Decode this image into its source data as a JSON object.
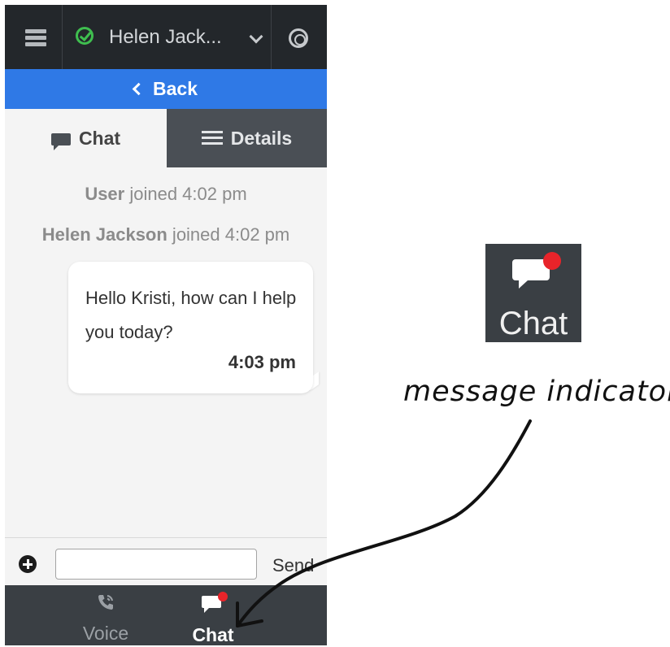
{
  "header": {
    "agent_name": "Helen Jack...",
    "status_color": "#3fbe4f"
  },
  "back_bar": {
    "label": "Back",
    "color": "#2f79e6"
  },
  "tabs": [
    {
      "label": "Chat",
      "icon": "chat-bubble-icon",
      "active": true
    },
    {
      "label": "Details",
      "icon": "list-icon",
      "active": false
    }
  ],
  "transcript": {
    "system_messages": [
      {
        "name": "User",
        "text": " joined 4:02 pm"
      },
      {
        "name": "Helen Jackson",
        "text": " joined 4:02 pm"
      }
    ],
    "message": {
      "text": "Hello Kristi, how can I help you today?",
      "time": "4:03 pm"
    }
  },
  "composer": {
    "value": "",
    "send_label": "Send"
  },
  "bottom_nav": {
    "voice_label": "Voice",
    "chat_label": "Chat",
    "indicator_color": "#e8242a"
  },
  "callout": {
    "label": "Chat",
    "annotation": "message indicator"
  }
}
